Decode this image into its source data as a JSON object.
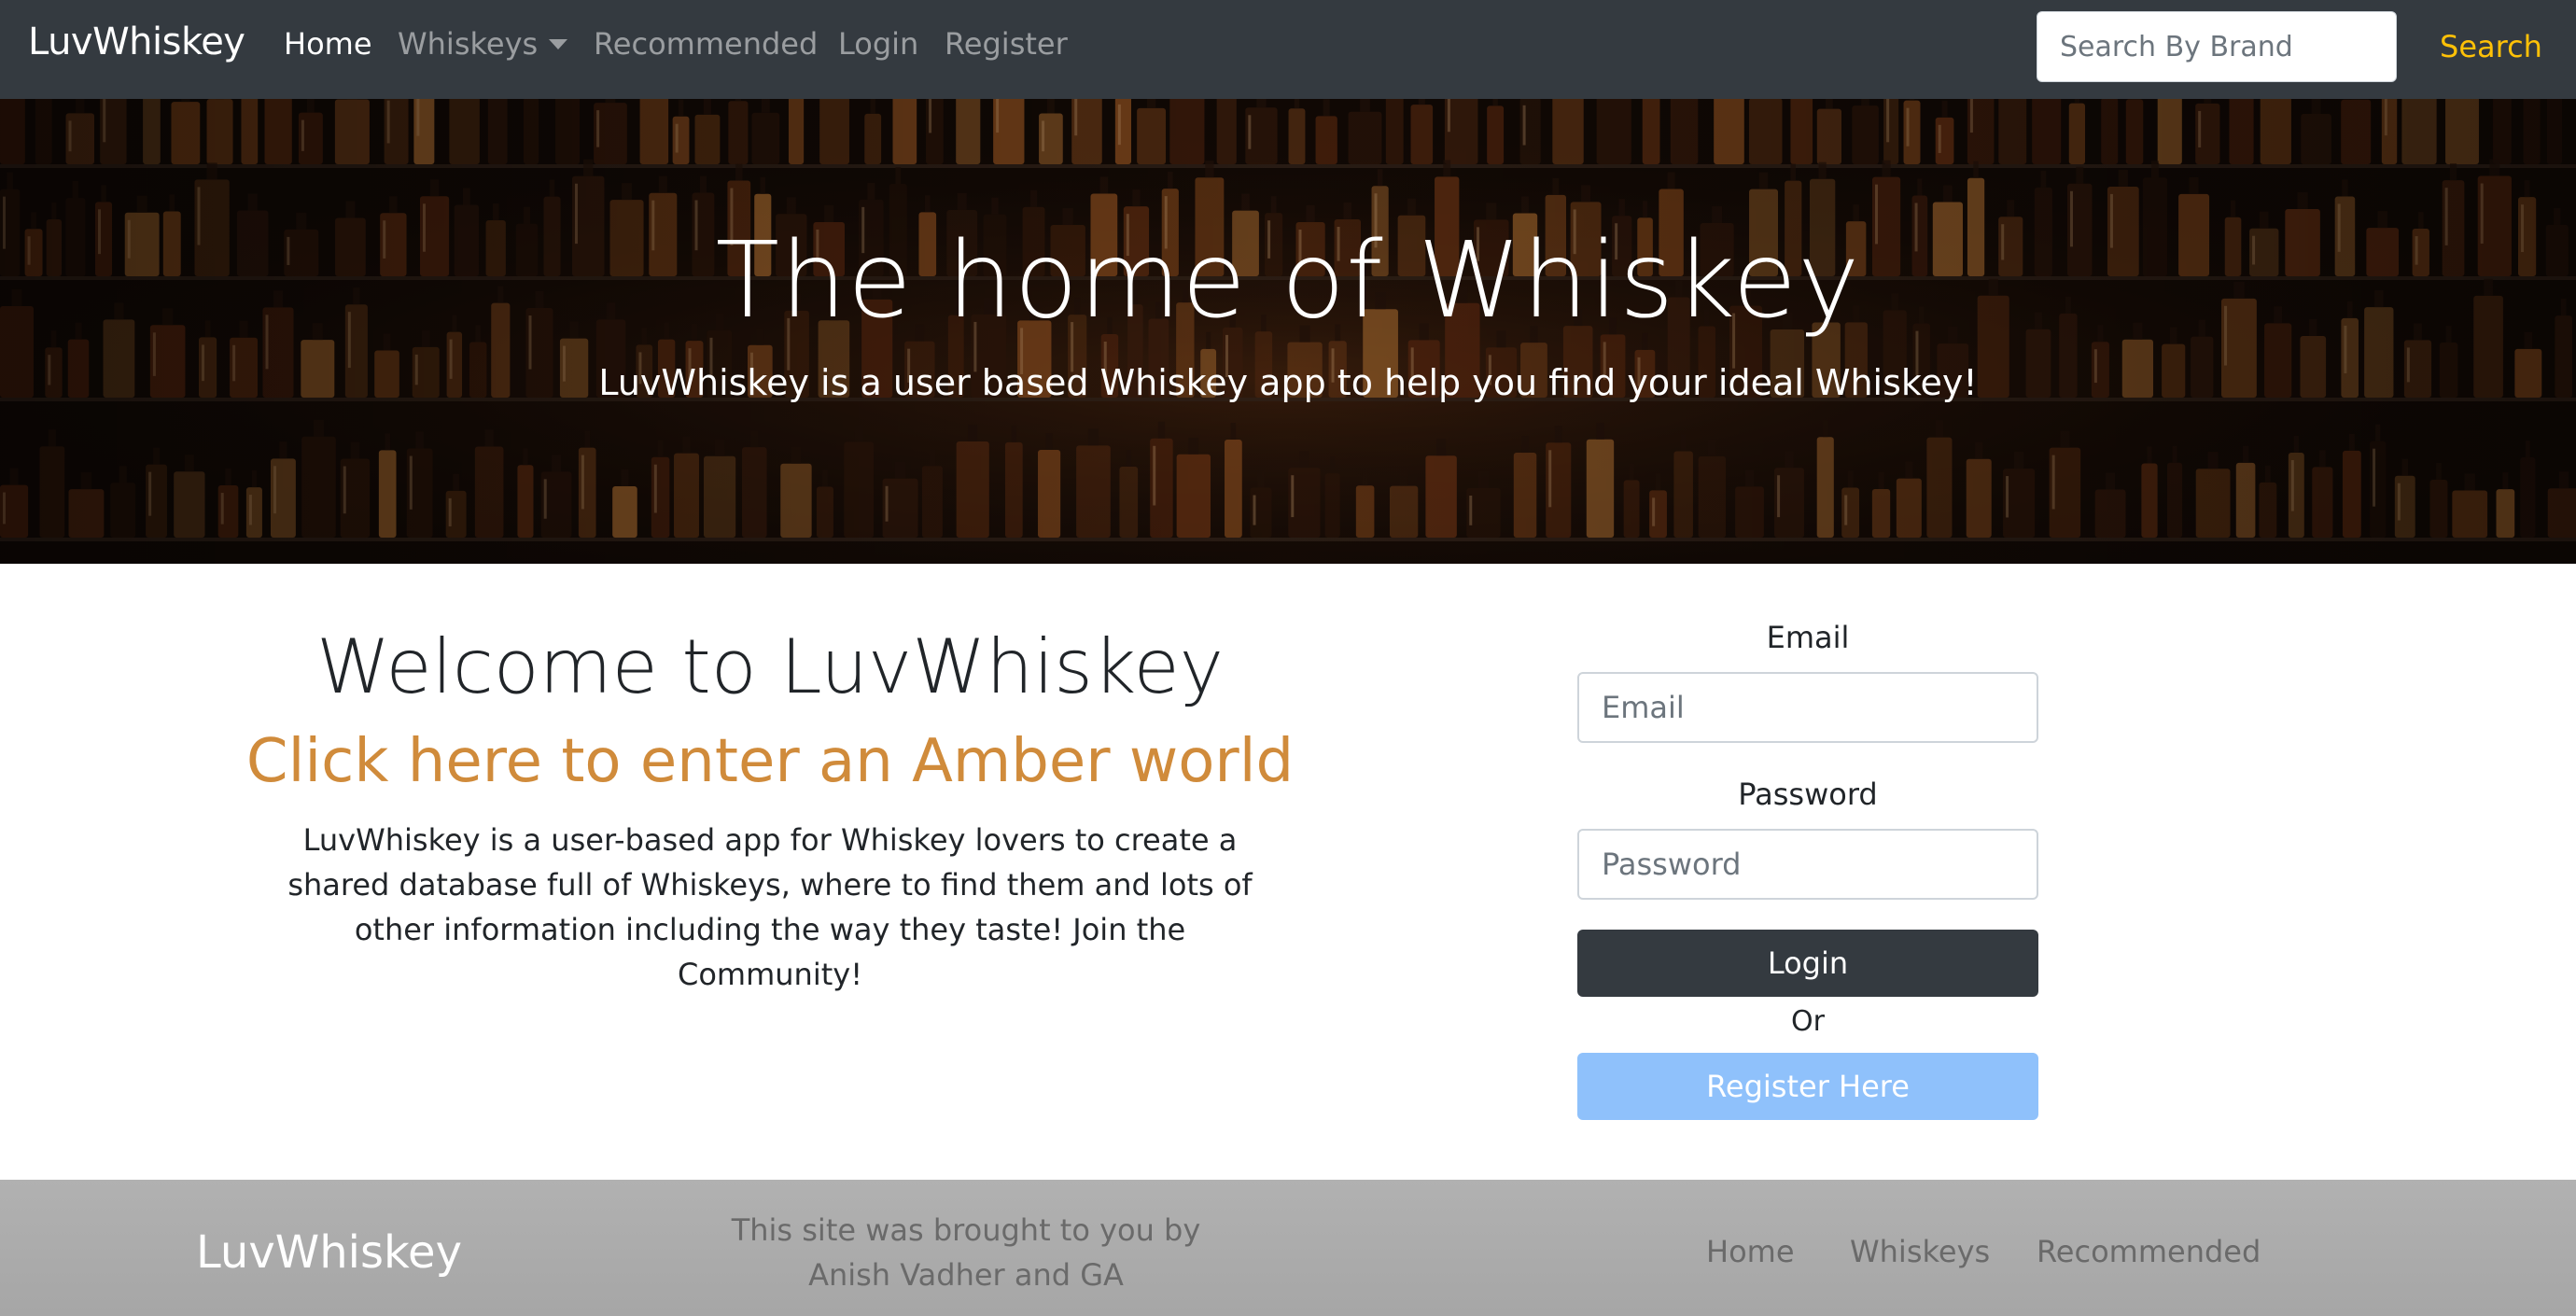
{
  "navbar": {
    "brand": "LuvWhiskey",
    "links": {
      "home": "Home",
      "whiskeys": "Whiskeys",
      "recommended": "Recommended",
      "login": "Login",
      "register": "Register"
    },
    "search_placeholder": "Search By Brand",
    "search_button": "Search"
  },
  "hero": {
    "title": "The home of Whiskey",
    "subtitle": "LuvWhiskey is a user based Whiskey app to help you find your ideal Whiskey!"
  },
  "welcome": {
    "title": "Welcome to LuvWhiskey",
    "link": "Click here to enter an Amber world",
    "description": "LuvWhiskey is a user-based app for Whiskey lovers to create a shared database full of Whiskeys, where to find them and lots of other information including the way they taste! Join the Community!"
  },
  "login_form": {
    "email_label": "Email",
    "email_placeholder": "Email",
    "password_label": "Password",
    "password_placeholder": "Password",
    "login_button": "Login",
    "or_text": "Or",
    "register_button": "Register Here"
  },
  "footer": {
    "brand": "LuvWhiskey",
    "credit": "This site was brought to you by Anish Vadher and GA",
    "links": {
      "home": "Home",
      "whiskeys": "Whiskeys",
      "recommended": "Recommended"
    }
  },
  "colors": {
    "navbar_bg": "#343a40",
    "search_accent": "#ffc107",
    "amber_link": "#d08b3b",
    "register_button": "#8fc1fb",
    "footer_bg": "#acacac"
  }
}
